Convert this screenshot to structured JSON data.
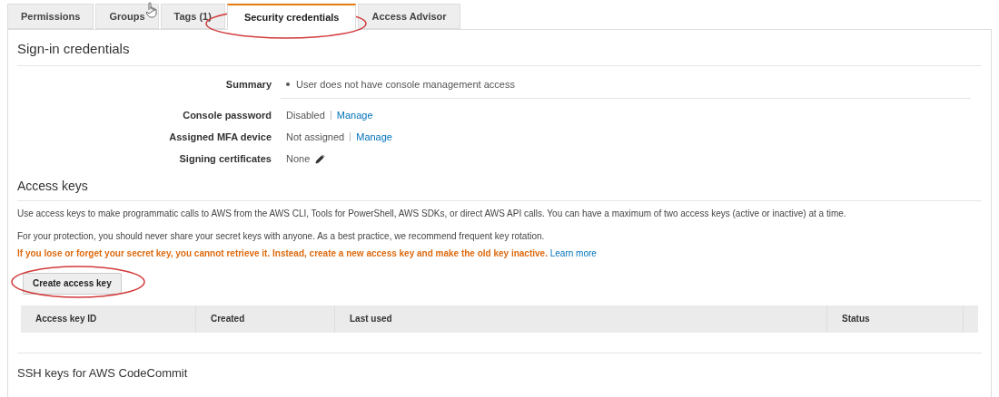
{
  "tabs": [
    {
      "label": "Permissions",
      "selected": false
    },
    {
      "label": "Groups",
      "selected": false
    },
    {
      "label": "Tags (1)",
      "selected": false
    },
    {
      "label": "Security credentials",
      "selected": true
    },
    {
      "label": "Access Advisor",
      "selected": false
    }
  ],
  "sign_in": {
    "title": "Sign-in credentials",
    "rows": [
      {
        "kind": "summary",
        "label": "Summary",
        "value": "User does not have console management access"
      },
      {
        "kind": "link",
        "label": "Console password",
        "value": "Disabled",
        "link": "Manage"
      },
      {
        "kind": "link",
        "label": "Assigned MFA device",
        "value": "Not assigned",
        "link": "Manage"
      },
      {
        "kind": "edit",
        "label": "Signing certificates",
        "value": "None"
      }
    ]
  },
  "access_keys": {
    "title": "Access keys",
    "description": "Use access keys to make programmatic calls to AWS from the AWS CLI, Tools for PowerShell, AWS SDKs, or direct AWS API calls. You can have a maximum of two access keys (active or inactive) at a time.",
    "note": "For your protection, you should never share your secret keys with anyone. As a best practice, we recommend frequent key rotation.",
    "warning": "If you lose or forget your secret key, you cannot retrieve it. Instead, create a new access key and make the old key inactive.",
    "learn_more": "Learn more",
    "button": "Create access key",
    "columns": [
      "Access key ID",
      "Created",
      "Last used",
      "Status"
    ]
  },
  "ssh": {
    "title": "SSH keys for AWS CodeCommit"
  }
}
